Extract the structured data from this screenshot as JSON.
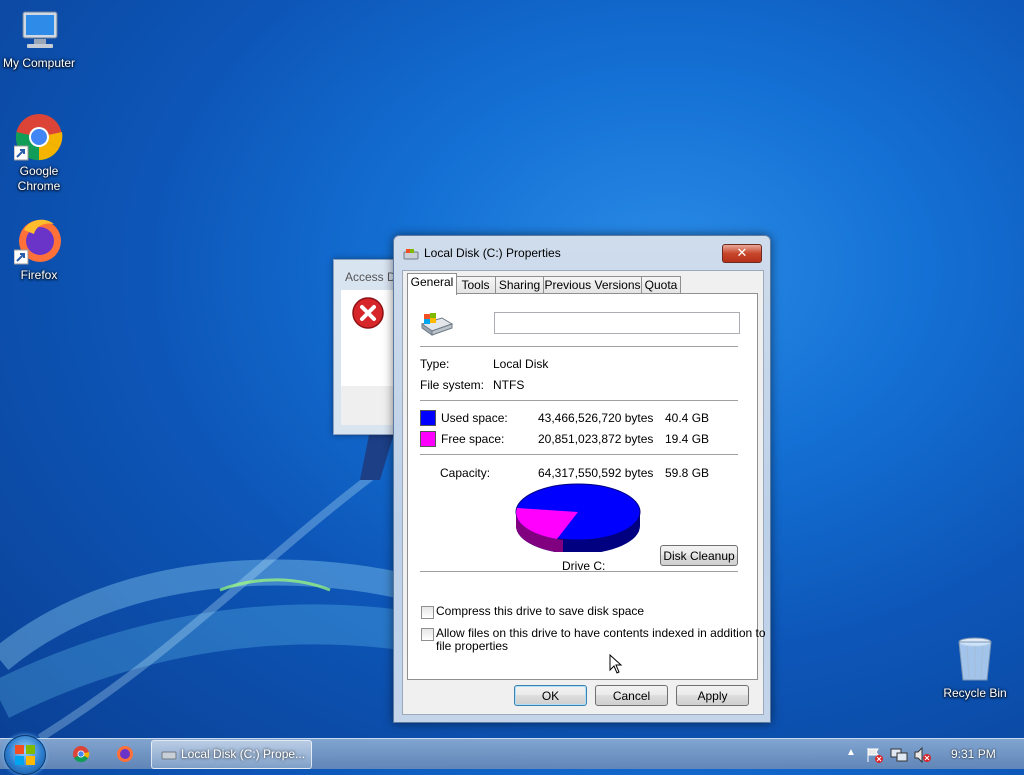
{
  "desktop": {
    "icons": [
      {
        "label": "My Computer",
        "icon": "my-computer-icon"
      },
      {
        "label": "Google Chrome",
        "icon": "chrome-icon"
      },
      {
        "label": "Firefox",
        "icon": "firefox-icon"
      },
      {
        "label": "Recycle Bin",
        "icon": "recycle-bin-icon"
      }
    ]
  },
  "access_dialog": {
    "title": "Access D"
  },
  "properties": {
    "title": "Local Disk (C:) Properties",
    "close_label": "✕",
    "tabs": [
      {
        "label": "General",
        "active": true
      },
      {
        "label": "Tools"
      },
      {
        "label": "Sharing"
      },
      {
        "label": "Previous Versions"
      },
      {
        "label": "Quota"
      }
    ],
    "name_value": "",
    "type_label": "Type:",
    "type_value": "Local Disk",
    "fs_label": "File system:",
    "fs_value": "NTFS",
    "used": {
      "label": "Used space:",
      "bytes": "43,466,526,720 bytes",
      "size": "40.4 GB",
      "color": "#0000ff"
    },
    "free": {
      "label": "Free space:",
      "bytes": "20,851,023,872 bytes",
      "size": "19.4 GB",
      "color": "#ff00ff"
    },
    "capacity": {
      "label": "Capacity:",
      "bytes": "64,317,550,592 bytes",
      "size": "59.8 GB"
    },
    "drive_label": "Drive C:",
    "disk_cleanup_label": "Disk Cleanup",
    "compress_label": "Compress this drive to save disk space",
    "index_label_1": "Allow files on this drive to have contents indexed in addition to",
    "index_label_2": "file properties",
    "ok_label": "OK",
    "cancel_label": "Cancel",
    "apply_label": "Apply"
  },
  "taskbar": {
    "task_label": "Local Disk (C:) Prope...",
    "clock": "9:31 PM"
  }
}
